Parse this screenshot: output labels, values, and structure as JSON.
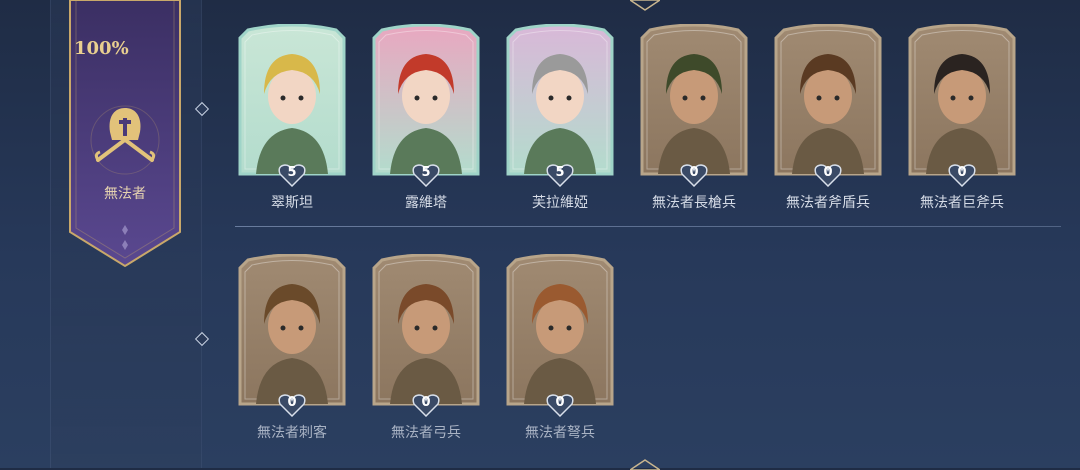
{
  "faction": {
    "percent": "100%",
    "name": "無法者",
    "emblem": "crossed-swords-helmet-icon"
  },
  "characters": [
    {
      "name": "翠斯坦",
      "count": "5",
      "rarity": "premium",
      "frame_color": "#9fd4c8",
      "bg": "#c9e6d6"
    },
    {
      "name": "露維塔",
      "count": "5",
      "rarity": "premium",
      "frame_color": "#9fd4c8",
      "bg": "#e9a7c0"
    },
    {
      "name": "芙拉維婭",
      "count": "5",
      "rarity": "premium",
      "frame_color": "#9fd4c8",
      "bg": "#d9b8d8"
    },
    {
      "name": "無法者長槍兵",
      "count": "0",
      "rarity": "common",
      "frame_color": "#b8a58a",
      "bg": "#a08a72"
    },
    {
      "name": "無法者斧盾兵",
      "count": "0",
      "rarity": "common",
      "frame_color": "#b8a58a",
      "bg": "#a08a72"
    },
    {
      "name": "無法者巨斧兵",
      "count": "0",
      "rarity": "common",
      "frame_color": "#b8a58a",
      "bg": "#a08a72"
    },
    {
      "name": "無法者刺客",
      "count": "0",
      "rarity": "common",
      "frame_color": "#b8a58a",
      "bg": "#a08a72"
    },
    {
      "name": "無法者弓兵",
      "count": "0",
      "rarity": "common",
      "frame_color": "#b8a58a",
      "bg": "#a08a72"
    },
    {
      "name": "無法者弩兵",
      "count": "0",
      "rarity": "common",
      "frame_color": "#b8a58a",
      "bg": "#a08a72"
    }
  ],
  "colors": {
    "banner": "#4a3a78",
    "banner_trim": "#c9a86a",
    "badge": "#3a4a66"
  }
}
